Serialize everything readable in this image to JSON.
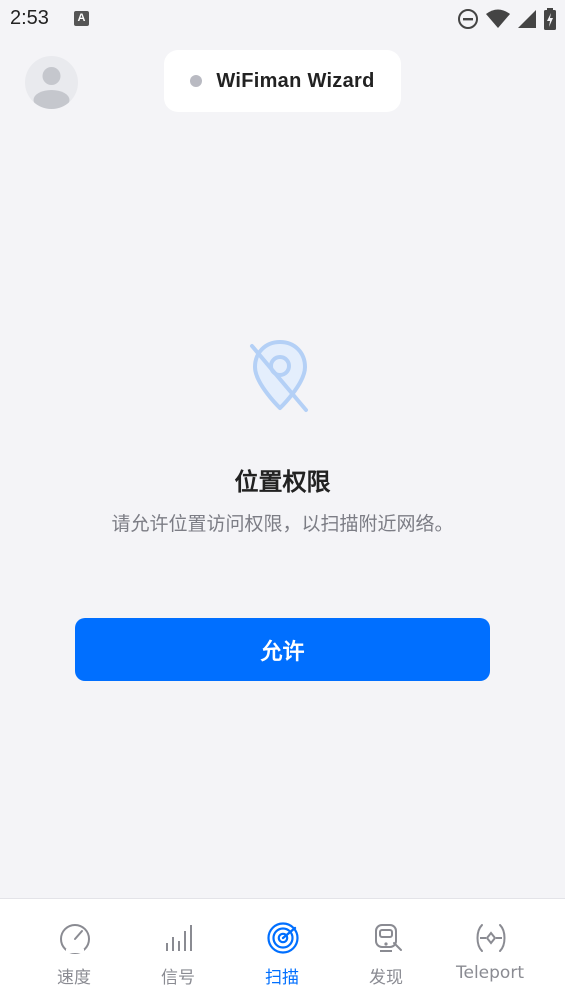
{
  "status_bar": {
    "time": "2:53",
    "notification_badge": "A"
  },
  "header": {
    "title": "WiFiman Wizard"
  },
  "permission": {
    "title": "位置权限",
    "description": "请允许位置访问权限，以扫描附近网络。",
    "allow_label": "允许"
  },
  "nav": {
    "active": "scan",
    "items": [
      {
        "id": "speed",
        "label": "速度",
        "icon": "speedometer-icon"
      },
      {
        "id": "signal",
        "label": "信号",
        "icon": "signal-bars-icon"
      },
      {
        "id": "scan",
        "label": "扫描",
        "icon": "radar-icon"
      },
      {
        "id": "discover",
        "label": "发现",
        "icon": "device-search-icon"
      },
      {
        "id": "teleport",
        "label": "Teleport",
        "icon": "teleport-icon"
      }
    ]
  },
  "colors": {
    "accent": "#006fff",
    "background": "#f4f4f7",
    "inactive": "#8a8b92"
  }
}
